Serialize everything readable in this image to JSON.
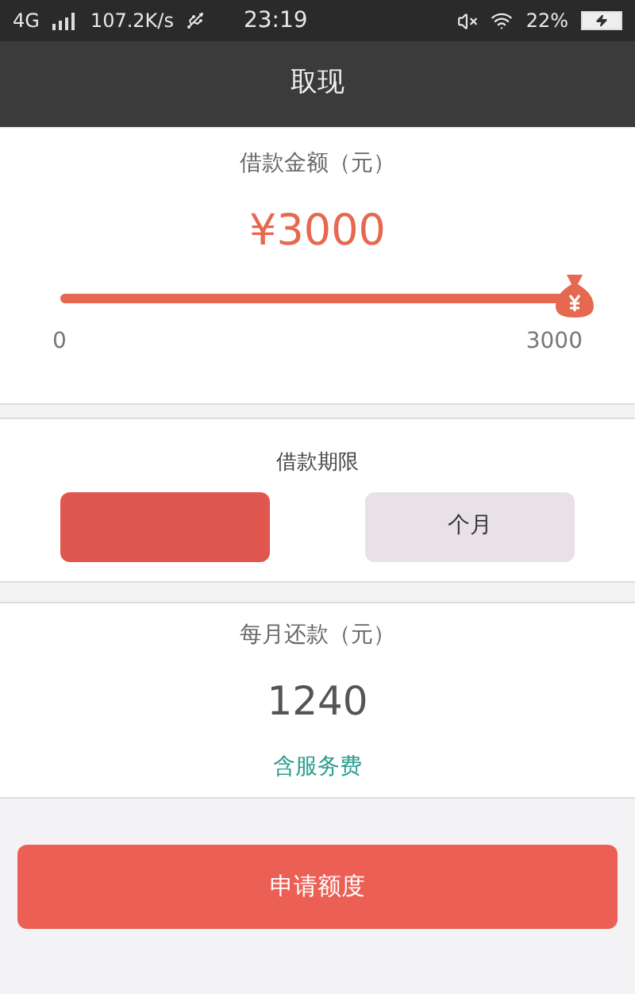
{
  "status_bar": {
    "network": "4G",
    "speed": "107.2K/s",
    "time": "23:19",
    "battery": "22%"
  },
  "nav": {
    "title": "取现"
  },
  "amount": {
    "label": "借款金额（元）",
    "value": "¥3000",
    "level": 1,
    "min": "0",
    "max": "3000"
  },
  "term": {
    "label": "借款期限",
    "options": [
      {
        "selected": true
      },
      {
        "label": "个月",
        "selected": false
      }
    ]
  },
  "repayment": {
    "label": "每月还款（元）",
    "value": "1240",
    "note": "含服务费"
  },
  "submit": {
    "label": "申请额度"
  }
}
